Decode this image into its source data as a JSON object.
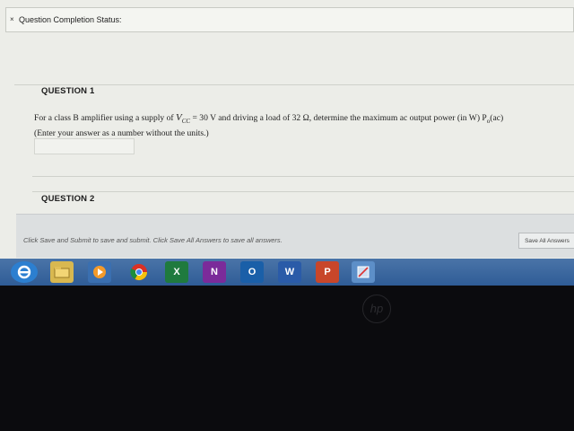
{
  "status": {
    "toggle": "×",
    "label": "Question Completion Status:"
  },
  "question1": {
    "heading": "QUESTION 1",
    "text_part1": "For a class B amplifier using a supply of ",
    "vcc_var": "V",
    "vcc_sub": "CC",
    "text_part2": " = 30 V and driving a load of 32 Ω, determine the maximum ac output power (in W) P",
    "p_sub": "o",
    "text_part3": "(ac)",
    "instruction": "(Enter your answer as a number without the units.)",
    "answer_value": ""
  },
  "question2": {
    "heading": "QUESTION 2"
  },
  "footer": {
    "save_text": "Click Save and Submit to save and submit. Click Save All Answers to save all answers.",
    "save_all_label": "Save All Answers"
  },
  "taskbar": {
    "excel_label": "X",
    "onenote_label": "N",
    "outlook_label": "O",
    "word_label": "W",
    "powerpoint_label": "P"
  },
  "bezel": {
    "logo": "hp"
  }
}
